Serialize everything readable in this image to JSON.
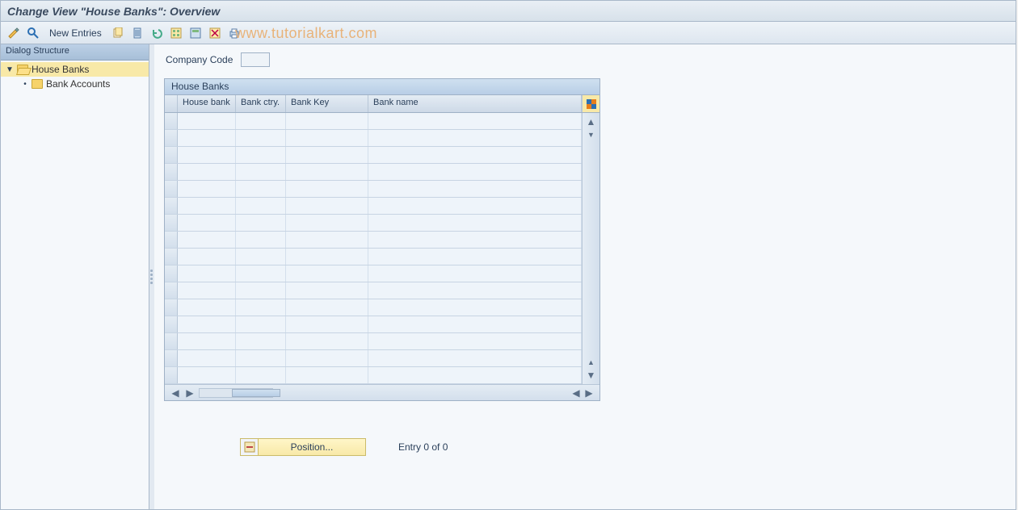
{
  "title": "Change View \"House Banks\": Overview",
  "toolbar": {
    "new_entries": "New Entries"
  },
  "watermark": "www.tutorialkart.com",
  "sidebar": {
    "title": "Dialog Structure",
    "nodes": [
      {
        "label": "House Banks"
      },
      {
        "label": "Bank Accounts"
      }
    ]
  },
  "fields": {
    "company_code_label": "Company Code",
    "company_code_value": ""
  },
  "table": {
    "title": "House Banks",
    "columns": [
      "House bank",
      "Bank ctry.",
      "Bank Key",
      "Bank name"
    ],
    "rows": 16
  },
  "footer": {
    "position_label": "Position...",
    "entry_text": "Entry 0 of 0"
  }
}
